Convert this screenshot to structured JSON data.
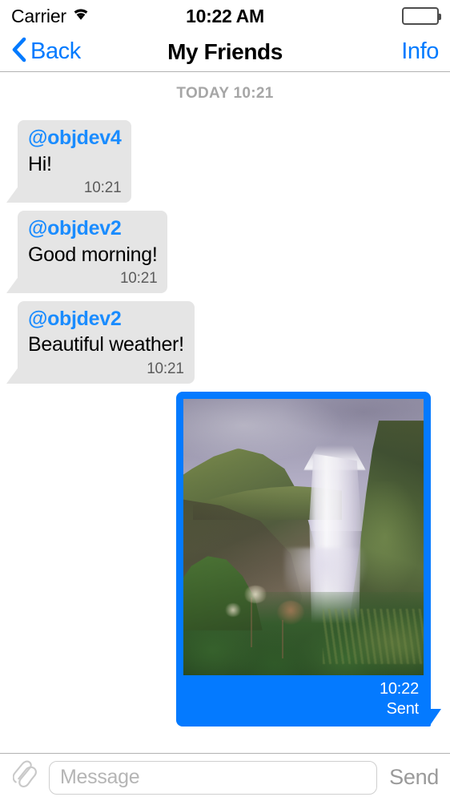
{
  "status_bar": {
    "carrier": "Carrier",
    "wifi_icon": "wifi-icon",
    "time": "10:22 AM",
    "battery_icon": "battery-icon",
    "battery_level": 96
  },
  "nav_bar": {
    "back_label": "Back",
    "back_icon": "chevron-left-icon",
    "title": "My Friends",
    "info_label": "Info"
  },
  "conversation": {
    "day_separator": "TODAY 10:21",
    "messages": [
      {
        "direction": "incoming",
        "sender": "@objdev4",
        "text": "Hi!",
        "time": "10:21"
      },
      {
        "direction": "incoming",
        "sender": "@objdev2",
        "text": "Good morning!",
        "time": "10:21"
      },
      {
        "direction": "incoming",
        "sender": "@objdev2",
        "text": "Beautiful weather!",
        "time": "10:21"
      },
      {
        "direction": "outgoing",
        "attachment": "photo-waterfall",
        "time": "10:22",
        "status": "Sent"
      }
    ]
  },
  "input_bar": {
    "attach_icon": "paperclip-icon",
    "message_placeholder": "Message",
    "message_value": "",
    "send_label": "Send"
  },
  "colors": {
    "accent_blue": "#007aff",
    "bubble_outgoing": "#047aff",
    "bubble_incoming": "#e5e5e5",
    "sender_blue": "#1a8cff",
    "meta_gray": "#5c5c5c",
    "separator_gray": "#a6a6a6",
    "send_disabled_gray": "#9a9a9a"
  }
}
